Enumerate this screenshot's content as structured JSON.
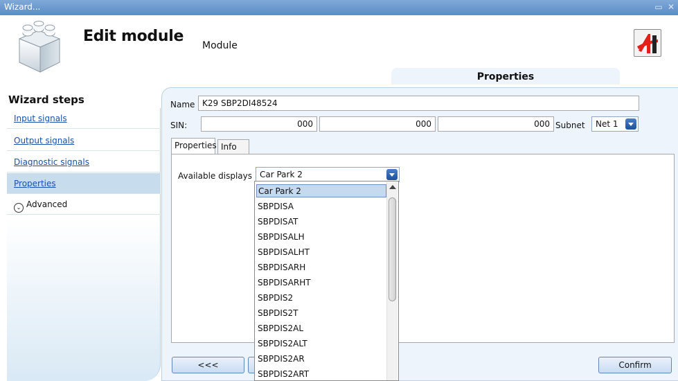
{
  "window": {
    "title": "Wizard..."
  },
  "header": {
    "title": "Edit module",
    "subtitle": "Module",
    "active_tab": "Properties"
  },
  "sidebar": {
    "title": "Wizard steps",
    "items": [
      {
        "label": "Input signals"
      },
      {
        "label": "Output signals"
      },
      {
        "label": "Diagnostic signals"
      },
      {
        "label": "Properties"
      },
      {
        "label": "Advanced"
      }
    ]
  },
  "form": {
    "name_label": "Name",
    "name_value": "K29 SBP2DI48524",
    "sin_label": "SIN:",
    "sin_values": [
      "000",
      "000",
      "000"
    ],
    "subnet_label": "Subnet",
    "subnet_value": "Net 1"
  },
  "tabs": [
    {
      "label": "Properties"
    },
    {
      "label": "Info"
    }
  ],
  "displays": {
    "label": "Available displays",
    "selected": "Car Park 2",
    "options": [
      "Car Park 2",
      "SBPDISA",
      "SBPDISAT",
      "SBPDISALH",
      "SBPDISALHT",
      "SBPDISARH",
      "SBPDISARHT",
      "SBPDIS2",
      "SBPDIS2T",
      "SBPDIS2AL",
      "SBPDIS2ALT",
      "SBPDIS2AR",
      "SBPDIS2ART"
    ]
  },
  "buttons": {
    "back": "<<<",
    "confirm": "Confirm"
  },
  "colors": {
    "accent": "#2a5db0",
    "panel": "#eef4fb",
    "titlebar": "#6b98cf",
    "logo_red": "#e0201b"
  }
}
